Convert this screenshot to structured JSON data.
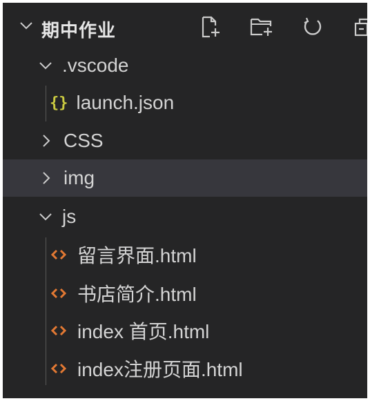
{
  "explorer": {
    "folder_title": "期中作业",
    "toolbar": {
      "new_file_icon": "new-file-icon",
      "new_folder_icon": "new-folder-icon",
      "refresh_icon": "refresh-icon",
      "collapse_icon": "collapse-all-icon"
    },
    "tree": [
      {
        "label": ".vscode",
        "type": "folder",
        "expanded": true
      },
      {
        "label": "launch.json",
        "type": "json-file",
        "icon_text": "{}"
      },
      {
        "label": "CSS",
        "type": "folder",
        "expanded": false
      },
      {
        "label": "img",
        "type": "folder",
        "expanded": false,
        "hovered": true
      },
      {
        "label": "js",
        "type": "folder",
        "expanded": true
      },
      {
        "label": "留言界面.html",
        "type": "html-file"
      },
      {
        "label": "书店简介.html",
        "type": "html-file"
      },
      {
        "label": "index 首页.html",
        "type": "html-file"
      },
      {
        "label": "index注册页面.html",
        "type": "html-file"
      }
    ],
    "colors": {
      "background": "#252526",
      "hover_row": "#37373d",
      "json_icon": "#cbcb41",
      "html_icon": "#e37933",
      "text": "#d4d4d4"
    }
  }
}
